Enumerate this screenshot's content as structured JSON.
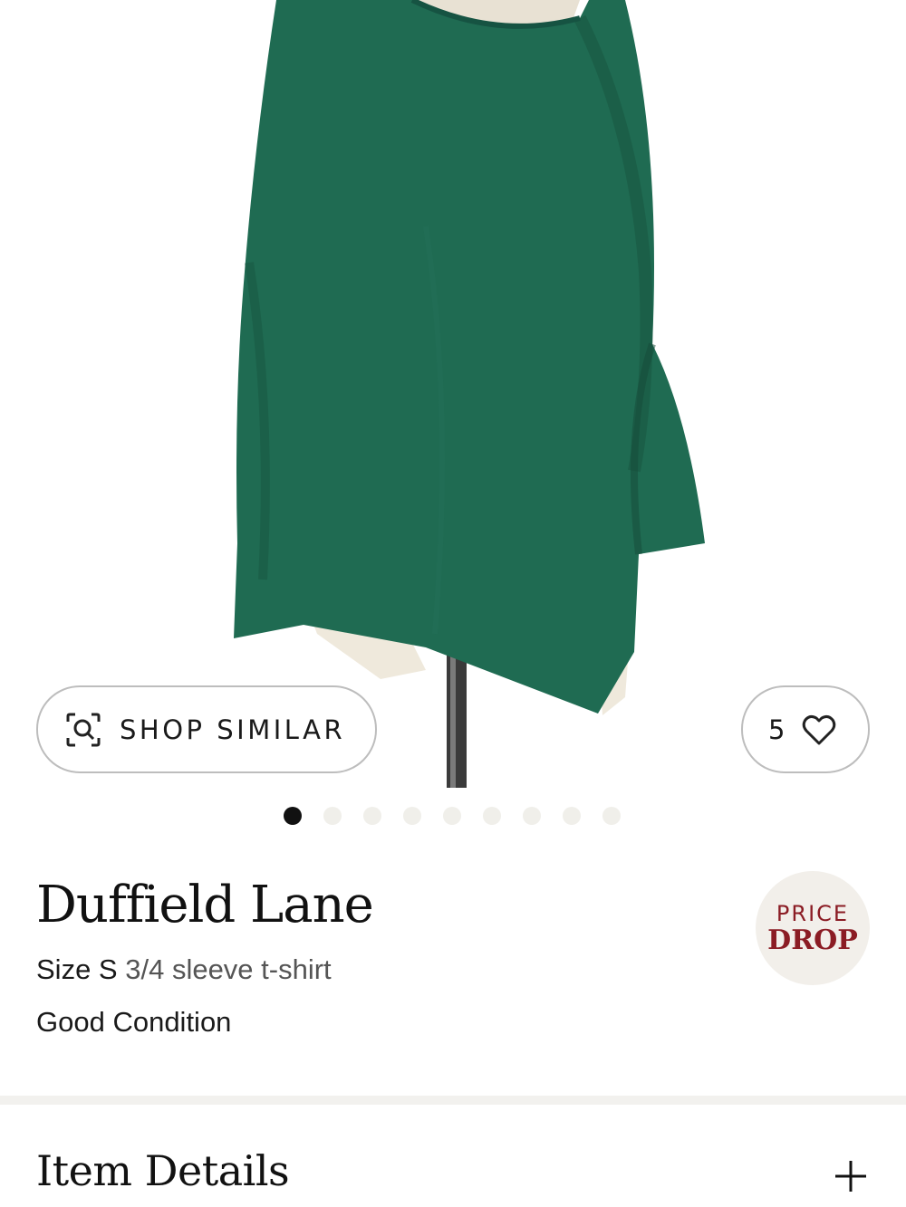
{
  "product_image": {
    "icon": "green-oversized-tshirt-on-mannequin",
    "garment_color": "#1f6b52"
  },
  "shop_similar": {
    "label": "SHOP SIMILAR",
    "icon": "visual-search-icon"
  },
  "favorites": {
    "count": "5",
    "icon": "heart-icon"
  },
  "carousel": {
    "total": 9,
    "active_index": 0
  },
  "product": {
    "brand": "Duffield Lane",
    "size_label": "Size S",
    "type": "3/4 sleeve t-shirt",
    "condition": "Good Condition"
  },
  "badge": {
    "line1": "PRICE",
    "line2": "DROP",
    "color": "#8b1c24"
  },
  "item_details": {
    "title": "Item Details",
    "icon": "plus-icon"
  }
}
